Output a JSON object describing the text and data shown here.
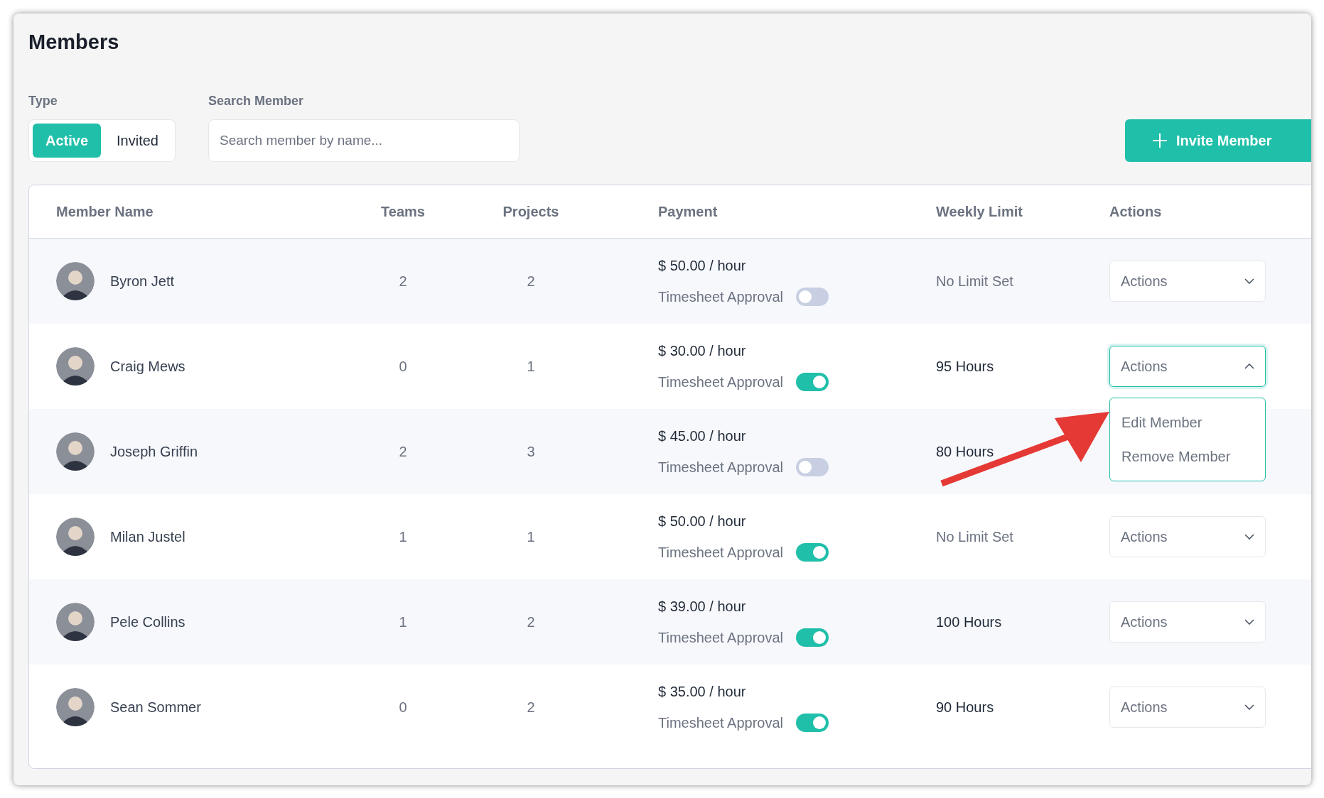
{
  "title": "Members",
  "type_filter": {
    "label": "Type",
    "options": [
      {
        "label": "Active",
        "selected": true
      },
      {
        "label": "Invited",
        "selected": false
      }
    ]
  },
  "search": {
    "label": "Search Member",
    "placeholder": "Search member by name..."
  },
  "invite_button": {
    "label": "Invite Member"
  },
  "table": {
    "columns": [
      "Member Name",
      "Teams",
      "Projects",
      "Payment",
      "Weekly Limit",
      "Actions"
    ],
    "rows": [
      {
        "name": "Byron Jett",
        "teams": "2",
        "projects": "2",
        "rate": "$ 50.00 / hour",
        "approval_label": "Timesheet Approval",
        "approval_on": false,
        "weekly_limit": "No Limit Set",
        "limit_set": false,
        "actions": {
          "label": "Actions",
          "expanded": false
        }
      },
      {
        "name": "Craig Mews",
        "teams": "0",
        "projects": "1",
        "rate": "$ 30.00 / hour",
        "approval_label": "Timesheet Approval",
        "approval_on": true,
        "weekly_limit": "95 Hours",
        "limit_set": true,
        "actions": {
          "label": "Actions",
          "expanded": true,
          "menu": [
            "Edit Member",
            "Remove Member"
          ]
        }
      },
      {
        "name": "Joseph Griffin",
        "teams": "2",
        "projects": "3",
        "rate": "$ 45.00 / hour",
        "approval_label": "Timesheet Approval",
        "approval_on": false,
        "weekly_limit": "80 Hours",
        "limit_set": true
      },
      {
        "name": "Milan Justel",
        "teams": "1",
        "projects": "1",
        "rate": "$ 50.00 / hour",
        "approval_label": "Timesheet Approval",
        "approval_on": true,
        "weekly_limit": "No Limit Set",
        "limit_set": false,
        "actions": {
          "label": "Actions",
          "expanded": false
        }
      },
      {
        "name": "Pele Collins",
        "teams": "1",
        "projects": "2",
        "rate": "$ 39.00 / hour",
        "approval_label": "Timesheet Approval",
        "approval_on": true,
        "weekly_limit": "100 Hours",
        "limit_set": true,
        "actions": {
          "label": "Actions",
          "expanded": false
        }
      },
      {
        "name": "Sean Sommer",
        "teams": "0",
        "projects": "2",
        "rate": "$ 35.00 / hour",
        "approval_label": "Timesheet Approval",
        "approval_on": true,
        "weekly_limit": "90 Hours",
        "limit_set": true,
        "actions": {
          "label": "Actions",
          "expanded": false
        }
      }
    ]
  }
}
